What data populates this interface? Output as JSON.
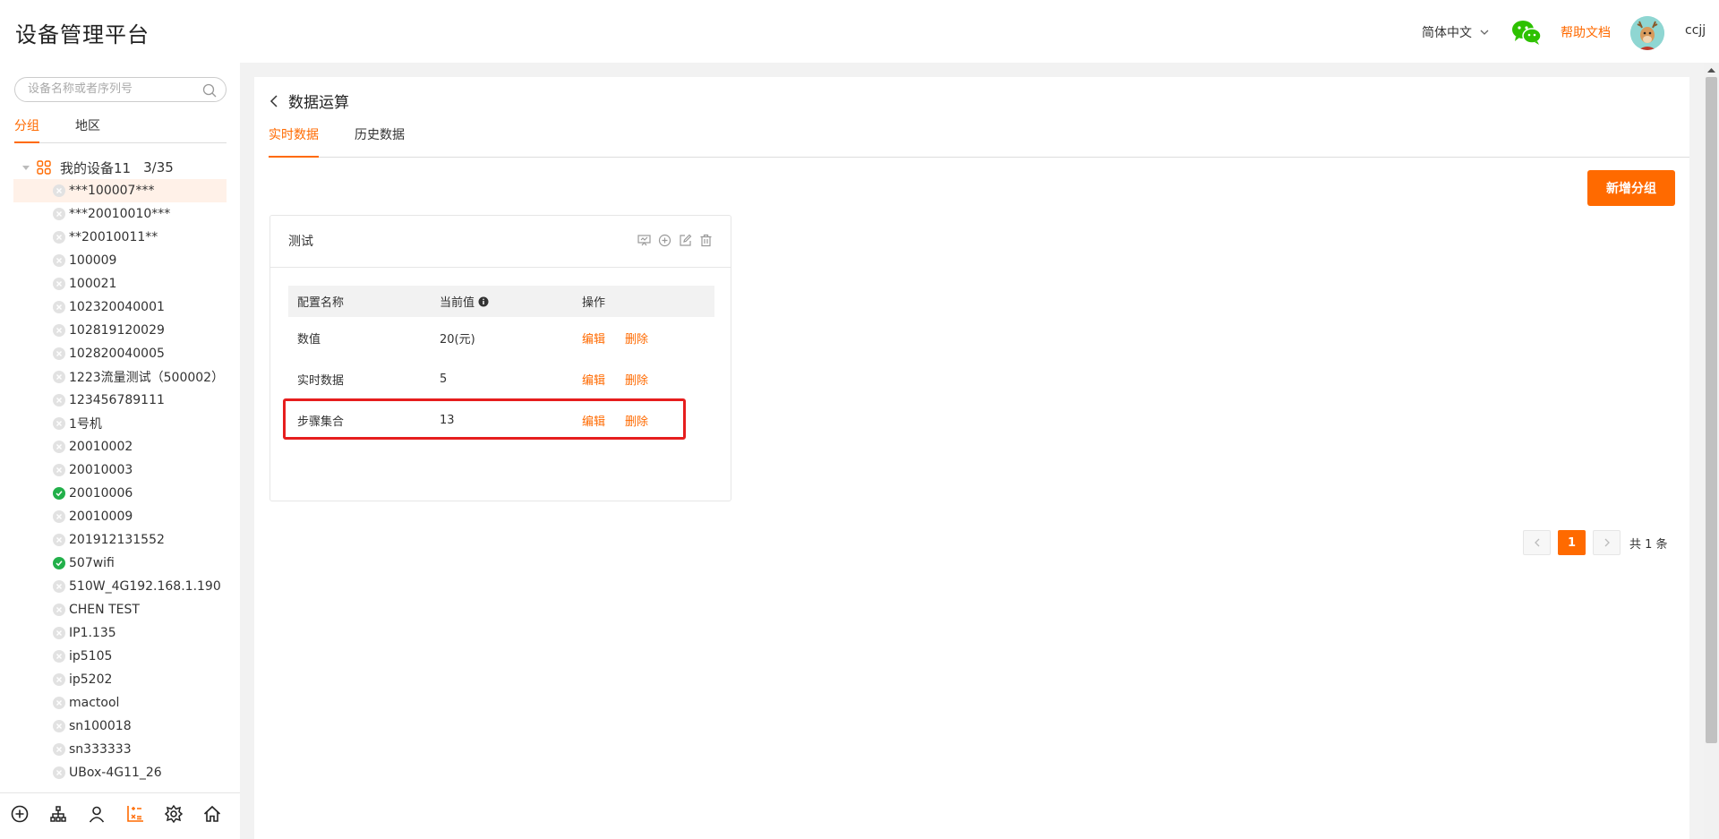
{
  "header": {
    "app_title": "设备管理平台",
    "language": "简体中文",
    "help_link": "帮助文档",
    "username": "ccjj"
  },
  "sidebar": {
    "search_placeholder": "设备名称或者序列号",
    "tabs": [
      "分组",
      "地区"
    ],
    "active_tab": "分组",
    "group_name": "我的设备11",
    "group_count": "3/35",
    "devices": [
      {
        "name": "***100007***",
        "online": false,
        "selected": true
      },
      {
        "name": "***20010010***",
        "online": false
      },
      {
        "name": "**20010011**",
        "online": false
      },
      {
        "name": "100009",
        "online": false
      },
      {
        "name": "100021",
        "online": false
      },
      {
        "name": "102320040001",
        "online": false
      },
      {
        "name": "102819120029",
        "online": false
      },
      {
        "name": "102820040005",
        "online": false
      },
      {
        "name": "1223流量测试（500002）",
        "online": false
      },
      {
        "name": "123456789111",
        "online": false
      },
      {
        "name": "1号机",
        "online": false
      },
      {
        "name": "20010002",
        "online": false
      },
      {
        "name": "20010003",
        "online": false
      },
      {
        "name": "20010006",
        "online": true
      },
      {
        "name": "20010009",
        "online": false
      },
      {
        "name": "201912131552",
        "online": false
      },
      {
        "name": "507wifi",
        "online": true
      },
      {
        "name": "510W_4G192.168.1.190",
        "online": false
      },
      {
        "name": "CHEN TEST",
        "online": false
      },
      {
        "name": "IP1.135",
        "online": false
      },
      {
        "name": "ip5105",
        "online": false
      },
      {
        "name": "ip5202",
        "online": false
      },
      {
        "name": "mactool",
        "online": false
      },
      {
        "name": "sn100018",
        "online": false
      },
      {
        "name": "sn333333",
        "online": false
      },
      {
        "name": "UBox-4G11_26",
        "online": false
      }
    ],
    "bottom_icons": [
      "add-circle-icon",
      "org-tree-icon",
      "user-icon",
      "data-calc-icon",
      "settings-flower-icon",
      "home-icon"
    ],
    "active_bottom_icon": "data-calc-icon"
  },
  "main": {
    "page_title": "数据运算",
    "tabs": [
      "实时数据",
      "历史数据"
    ],
    "active_tab": "实时数据",
    "add_group_button": "新增分组",
    "card": {
      "title": "测试",
      "tools": [
        "monitor-icon",
        "add-circle-icon",
        "edit-icon",
        "trash-icon"
      ],
      "columns": [
        "配置名称",
        "当前值",
        "操作"
      ],
      "rows": [
        {
          "name": "数值",
          "value": "20(元)",
          "edit": "编辑",
          "delete": "删除"
        },
        {
          "name": "实时数据",
          "value": "5",
          "edit": "编辑",
          "delete": "删除"
        },
        {
          "name": "步骤集合",
          "value": "13",
          "edit": "编辑",
          "delete": "删除"
        }
      ],
      "highlighted_row": 2
    },
    "pagination": {
      "current_page": "1",
      "total_text": "共 1 条"
    }
  },
  "colors": {
    "accent": "#ff6a00",
    "online": "#22b04a",
    "highlight_border": "#e61e1e"
  }
}
